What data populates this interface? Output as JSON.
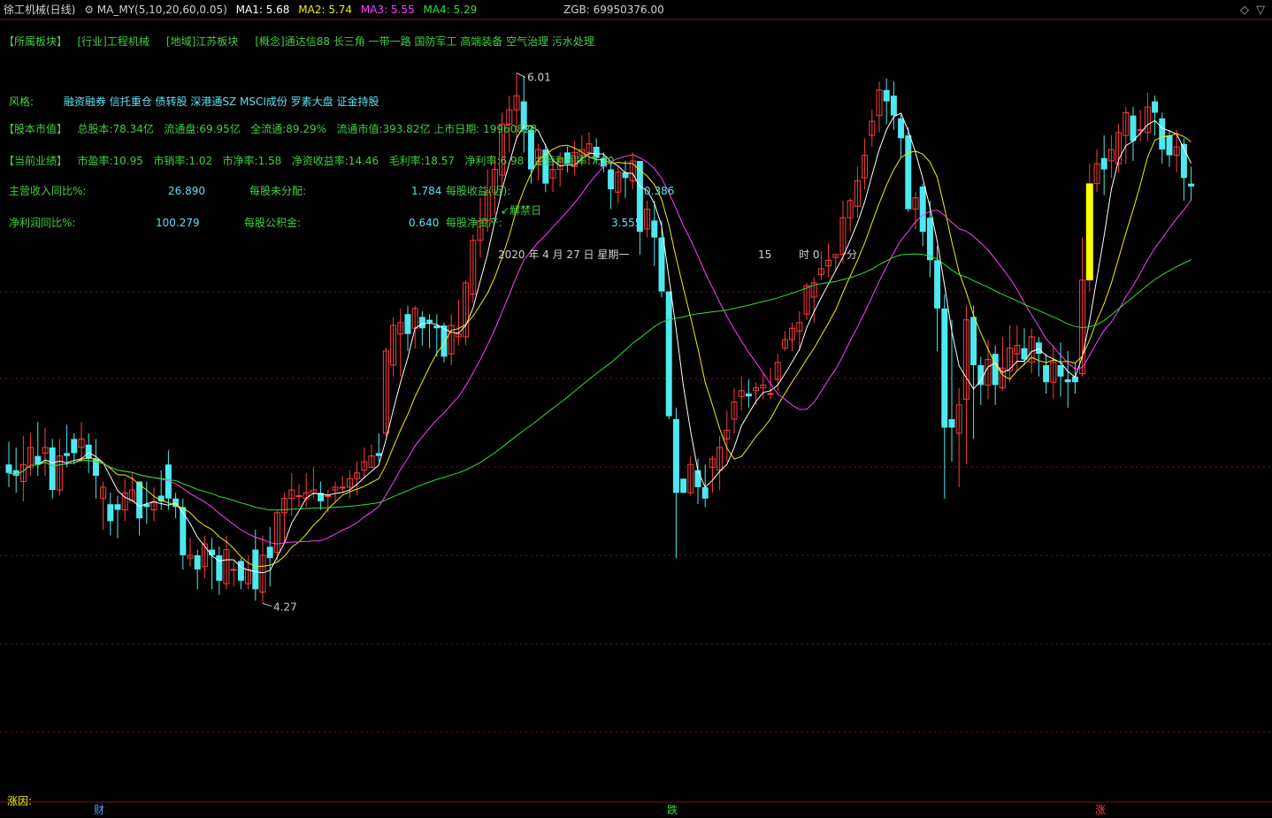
{
  "header": {
    "title": "徐工机械(日线)",
    "indicator": "MA_MY(5,10,20,60,0.05)",
    "ma1_label": "MA1: 5.68",
    "ma2_label": "MA2: 5.74",
    "ma3_label": "MA3: 5.55",
    "ma4_label": "MA4: 5.29",
    "zgb": "ZGB: 69950376.00",
    "colors": {
      "ma1": "#ffffff",
      "ma2": "#f0f000",
      "ma3": "#ff40ff",
      "ma4": "#30e030"
    }
  },
  "info": {
    "sector_label": "【所属板块】",
    "industry": "[行业]工程机械",
    "region": "[地域]江苏板块",
    "concept": "[概念]通达信88 长三角 一带一路 国防军工 高端装备 空气治理 污水处理",
    "style_label": "风格:",
    "style": "融资融券 信托重仓 债转股 深港通SZ MSCI成份 罗素大盘 证金持股",
    "cap_label": "【股本市值】",
    "total_shares": "总股本:78.34亿",
    "float_shares": "流通盘:69.95亿",
    "full_float": "全流通:89.29%",
    "float_cap": "流通市值:393.82亿 上市日期: 19960828",
    "perf_label": "【当前业绩】",
    "pe": "市盈率:10.95",
    "ps": "市销率:1.02",
    "pb": "市净率:1.58",
    "roe": "净资收益率:14.46",
    "gross": "毛利率:18.57",
    "net_margin": "净利率:6.98",
    "main_margin": "主营利润率:7.30",
    "rev_yoy_label": "主营收入同比%:",
    "rev_yoy": "26.890",
    "undistributed_label": "每股未分配:",
    "undistributed": "1.784",
    "eps_label": "每股收益(近):",
    "eps": "0.386",
    "profit_yoy_label": "净利润同比%:",
    "profit_yoy": "100.279",
    "reserve_label": "每股公积金:",
    "reserve": "0.640",
    "bps_label": "每股净资产:",
    "bps": "3.555",
    "unlock_label": "解禁日",
    "datetime": "2020 年 4 月 27 日  星期一",
    "hour": "15",
    "hour_unit": "时 0",
    "minute_unit": "分"
  },
  "footer": {
    "reason_label": "涨因:",
    "markers": [
      "财",
      "跌",
      "涨"
    ]
  },
  "chart_data": {
    "type": "candlestick",
    "ylim": [
      3.75,
      6.25
    ],
    "high_label": "6.01",
    "low_label": "4.27",
    "series_names": [
      "MA1",
      "MA2",
      "MA3",
      "MA4"
    ],
    "candles": [
      [
        4.7,
        4.67,
        4.78,
        4.62
      ],
      [
        4.68,
        4.66,
        4.76,
        4.6
      ],
      [
        4.64,
        4.7,
        4.8,
        4.57
      ],
      [
        4.69,
        4.76,
        4.81,
        4.66
      ],
      [
        4.73,
        4.7,
        4.85,
        4.66
      ],
      [
        4.74,
        4.76,
        4.83,
        4.66
      ],
      [
        4.76,
        4.61,
        4.79,
        4.58
      ],
      [
        4.61,
        4.73,
        4.79,
        4.59
      ],
      [
        4.74,
        4.73,
        4.84,
        4.69
      ],
      [
        4.79,
        4.74,
        4.81,
        4.7
      ],
      [
        4.76,
        4.79,
        4.85,
        4.71
      ],
      [
        4.77,
        4.72,
        4.81,
        4.67
      ],
      [
        4.72,
        4.66,
        4.79,
        4.58
      ],
      [
        4.58,
        4.62,
        4.64,
        4.47
      ],
      [
        4.56,
        4.5,
        4.6,
        4.45
      ],
      [
        4.56,
        4.54,
        4.59,
        4.44
      ],
      [
        4.54,
        4.6,
        4.65,
        4.5
      ],
      [
        4.57,
        4.61,
        4.67,
        4.57
      ],
      [
        4.64,
        4.51,
        4.64,
        4.45
      ],
      [
        4.56,
        4.55,
        4.64,
        4.49
      ],
      [
        4.54,
        4.57,
        4.62,
        4.5
      ],
      [
        4.59,
        4.57,
        4.68,
        4.54
      ],
      [
        4.7,
        4.58,
        4.75,
        4.54
      ],
      [
        4.58,
        4.55,
        4.6,
        4.51
      ],
      [
        4.55,
        4.38,
        4.58,
        4.33
      ],
      [
        4.37,
        4.38,
        4.44,
        4.34
      ],
      [
        4.38,
        4.33,
        4.4,
        4.26
      ],
      [
        4.34,
        4.42,
        4.45,
        4.3
      ],
      [
        4.4,
        4.38,
        4.44,
        4.26
      ],
      [
        4.38,
        4.29,
        4.41,
        4.24
      ],
      [
        4.28,
        4.4,
        4.45,
        4.26
      ],
      [
        4.33,
        4.33,
        4.36,
        4.27
      ],
      [
        4.36,
        4.29,
        4.37,
        4.26
      ],
      [
        4.28,
        4.33,
        4.38,
        4.26
      ],
      [
        4.4,
        4.26,
        4.47,
        4.22
      ],
      [
        4.25,
        4.38,
        4.45,
        4.21
      ],
      [
        4.41,
        4.37,
        4.48,
        4.27
      ],
      [
        4.39,
        4.53,
        4.54,
        4.36
      ],
      [
        4.53,
        4.58,
        4.6,
        4.42
      ],
      [
        4.58,
        4.61,
        4.67,
        4.52
      ],
      [
        4.59,
        4.59,
        4.63,
        4.55
      ],
      [
        4.58,
        4.6,
        4.67,
        4.55
      ],
      [
        4.6,
        4.61,
        4.69,
        4.58
      ],
      [
        4.6,
        4.57,
        4.64,
        4.54
      ],
      [
        4.59,
        4.59,
        4.61,
        4.53
      ],
      [
        4.61,
        4.62,
        4.64,
        4.57
      ],
      [
        4.62,
        4.62,
        4.66,
        4.6
      ],
      [
        4.62,
        4.65,
        4.68,
        4.58
      ],
      [
        4.65,
        4.67,
        4.71,
        4.59
      ],
      [
        4.68,
        4.71,
        4.76,
        4.65
      ],
      [
        4.69,
        4.73,
        4.77,
        4.69
      ],
      [
        4.74,
        4.73,
        4.81,
        4.71
      ],
      [
        4.81,
        5.1,
        5.11,
        4.8
      ],
      [
        5.05,
        5.19,
        5.22,
        5.01
      ],
      [
        5.16,
        5.2,
        5.25,
        5.01
      ],
      [
        5.23,
        5.16,
        5.26,
        5.1
      ],
      [
        5.18,
        5.25,
        5.26,
        5.11
      ],
      [
        5.22,
        5.18,
        5.24,
        5.12
      ],
      [
        5.21,
        5.2,
        5.23,
        5.11
      ],
      [
        5.19,
        5.18,
        5.23,
        5.08
      ],
      [
        5.19,
        5.08,
        5.2,
        5.06
      ],
      [
        5.09,
        5.19,
        5.23,
        5.05
      ],
      [
        5.15,
        5.16,
        5.28,
        5.12
      ],
      [
        5.15,
        5.34,
        5.35,
        5.12
      ],
      [
        5.3,
        5.49,
        5.51,
        5.27
      ],
      [
        5.49,
        5.56,
        5.64,
        5.43
      ],
      [
        5.56,
        5.66,
        5.74,
        5.52
      ],
      [
        5.66,
        5.74,
        5.78,
        5.58
      ],
      [
        5.72,
        5.9,
        5.94,
        5.66
      ],
      [
        5.9,
        5.95,
        6.0,
        5.8
      ],
      [
        5.95,
        6.0,
        6.08,
        5.85
      ],
      [
        5.98,
        5.88,
        6.07,
        5.8
      ],
      [
        5.88,
        5.74,
        5.89,
        5.69
      ],
      [
        5.76,
        5.81,
        5.83,
        5.7
      ],
      [
        5.81,
        5.69,
        5.83,
        5.66
      ],
      [
        5.71,
        5.74,
        5.78,
        5.66
      ],
      [
        5.74,
        5.78,
        5.8,
        5.68
      ],
      [
        5.8,
        5.76,
        5.82,
        5.73
      ],
      [
        5.75,
        5.8,
        5.84,
        5.72
      ],
      [
        5.79,
        5.81,
        5.86,
        5.76
      ],
      [
        5.8,
        5.83,
        5.87,
        5.76
      ],
      [
        5.82,
        5.78,
        5.85,
        5.76
      ],
      [
        5.78,
        5.75,
        5.8,
        5.73
      ],
      [
        5.74,
        5.67,
        5.76,
        5.6
      ],
      [
        5.66,
        5.73,
        5.75,
        5.62
      ],
      [
        5.73,
        5.71,
        5.77,
        5.64
      ],
      [
        5.7,
        5.77,
        5.8,
        5.67
      ],
      [
        5.77,
        5.52,
        5.77,
        5.44
      ],
      [
        5.53,
        5.6,
        5.63,
        5.5
      ],
      [
        5.56,
        5.5,
        5.63,
        5.4
      ],
      [
        5.5,
        5.31,
        5.56,
        5.29
      ],
      [
        5.31,
        4.87,
        5.31,
        4.86
      ],
      [
        4.86,
        4.6,
        4.9,
        4.37
      ],
      [
        4.65,
        4.6,
        4.6,
        4.65
      ],
      [
        4.6,
        4.7,
        4.73,
        4.59
      ],
      [
        4.68,
        4.62,
        4.72,
        4.56
      ],
      [
        4.62,
        4.58,
        4.7,
        4.55
      ],
      [
        4.69,
        4.72,
        4.73,
        4.6
      ],
      [
        4.68,
        4.76,
        4.8,
        4.61
      ],
      [
        4.79,
        4.82,
        4.89,
        4.71
      ],
      [
        4.86,
        4.92,
        4.97,
        4.81
      ],
      [
        4.94,
        4.96,
        5.01,
        4.89
      ],
      [
        4.95,
        4.94,
        5.0,
        4.9
      ],
      [
        4.96,
        4.97,
        4.99,
        4.91
      ],
      [
        4.97,
        4.98,
        5.02,
        4.93
      ],
      [
        4.95,
        4.95,
        5.04,
        4.93
      ],
      [
        5.0,
        5.06,
        5.09,
        4.96
      ],
      [
        5.11,
        5.14,
        5.17,
        5.1
      ],
      [
        5.14,
        5.18,
        5.2,
        5.1
      ],
      [
        5.17,
        5.2,
        5.24,
        5.1
      ],
      [
        5.23,
        5.33,
        5.34,
        5.21
      ],
      [
        5.29,
        5.34,
        5.36,
        5.2
      ],
      [
        5.37,
        5.39,
        5.45,
        5.35
      ],
      [
        5.4,
        5.42,
        5.48,
        5.36
      ],
      [
        5.43,
        5.44,
        5.44,
        5.38
      ],
      [
        5.44,
        5.57,
        5.63,
        5.41
      ],
      [
        5.57,
        5.63,
        5.64,
        5.52
      ],
      [
        5.61,
        5.7,
        5.75,
        5.57
      ],
      [
        5.71,
        5.79,
        5.85,
        5.67
      ],
      [
        5.86,
        5.91,
        5.95,
        5.82
      ],
      [
        5.93,
        6.02,
        6.05,
        5.87
      ],
      [
        6.02,
        5.98,
        6.06,
        5.9
      ],
      [
        6.0,
        5.93,
        6.05,
        5.88
      ],
      [
        5.92,
        5.85,
        5.94,
        5.78
      ],
      [
        5.86,
        5.6,
        5.89,
        5.59
      ],
      [
        5.6,
        5.64,
        5.66,
        5.53
      ],
      [
        5.68,
        5.52,
        5.69,
        5.47
      ],
      [
        5.57,
        5.42,
        5.63,
        5.36
      ],
      [
        5.42,
        5.25,
        5.47,
        5.1
      ],
      [
        5.25,
        4.83,
        5.3,
        4.58
      ],
      [
        4.86,
        4.83,
        5.21,
        4.71
      ],
      [
        4.81,
        4.91,
        4.97,
        4.62
      ],
      [
        4.93,
        5.21,
        5.26,
        4.7
      ],
      [
        5.22,
        5.05,
        5.26,
        4.79
      ],
      [
        5.05,
        4.98,
        5.08,
        4.91
      ],
      [
        4.98,
        5.07,
        5.14,
        4.93
      ],
      [
        5.09,
        4.98,
        5.12,
        4.91
      ],
      [
        4.97,
        5.04,
        5.15,
        4.96
      ],
      [
        5.03,
        5.11,
        5.19,
        4.99
      ],
      [
        5.09,
        5.12,
        5.19,
        5.03
      ],
      [
        5.11,
        5.07,
        5.18,
        5.05
      ],
      [
        5.06,
        5.15,
        5.18,
        5.02
      ],
      [
        5.13,
        5.09,
        5.15,
        5.01
      ],
      [
        5.05,
        4.99,
        5.09,
        4.95
      ],
      [
        4.99,
        5.06,
        5.12,
        4.93
      ],
      [
        5.05,
        5.01,
        5.13,
        4.94
      ],
      [
        5.0,
        4.99,
        5.1,
        4.9
      ],
      [
        5.01,
        4.99,
        5.06,
        4.95
      ],
      [
        5.02,
        5.35,
        5.5,
        5.01
      ],
      [
        5.35,
        5.69,
        5.76,
        5.31
      ],
      [
        5.69,
        5.76,
        5.81,
        5.66
      ],
      [
        5.78,
        5.74,
        5.86,
        5.65
      ],
      [
        5.77,
        5.81,
        5.86,
        5.71
      ],
      [
        5.76,
        5.87,
        5.9,
        5.73
      ],
      [
        5.86,
        5.94,
        5.96,
        5.76
      ],
      [
        5.93,
        5.84,
        5.96,
        5.77
      ],
      [
        5.88,
        5.88,
        5.95,
        5.84
      ],
      [
        5.87,
        5.96,
        6.01,
        5.84
      ],
      [
        5.98,
        5.94,
        6.0,
        5.86
      ],
      [
        5.92,
        5.81,
        5.94,
        5.76
      ],
      [
        5.86,
        5.79,
        5.88,
        5.75
      ],
      [
        5.79,
        5.82,
        5.88,
        5.73
      ],
      [
        5.83,
        5.71,
        5.85,
        5.63
      ],
      [
        5.69,
        5.68,
        5.75,
        5.63
      ]
    ]
  }
}
